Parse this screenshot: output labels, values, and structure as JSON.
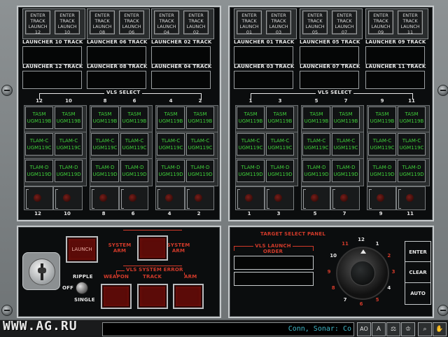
{
  "left_top": {
    "enter_buttons": [
      {
        "line1": "ENTER",
        "line2": "TRACK",
        "line3": "LAUNCH",
        "num": "12"
      },
      {
        "line1": "ENTER",
        "line2": "TRACK",
        "line3": "LAUNCH",
        "num": "10"
      },
      {
        "line1": "ENTER",
        "line2": "TRACK",
        "line3": "LAUNCH",
        "num": "08"
      },
      {
        "line1": "ENTER",
        "line2": "TRACK",
        "line3": "LAUNCH",
        "num": "06"
      },
      {
        "line1": "ENTER",
        "line2": "TRACK",
        "line3": "LAUNCH",
        "num": "04"
      },
      {
        "line1": "ENTER",
        "line2": "TRACK",
        "line3": "LAUNCH",
        "num": "02"
      }
    ],
    "track_labels_row1": [
      "LAUNCHER 10 TRACK",
      "LAUNCHER 06 TRACK",
      "LAUNCHER 02 TRACK"
    ],
    "track_labels_row2": [
      "LAUNCHER 12 TRACK",
      "LAUNCHER 08 TRACK",
      "LAUNCHER 04 TRACK"
    ],
    "vls_select": "VLS SELECT",
    "tube_numbers": [
      "12",
      "10",
      "8",
      "6",
      "4",
      "2"
    ]
  },
  "right_top": {
    "enter_buttons": [
      {
        "line1": "ENTER",
        "line2": "TRACK",
        "line3": "LAUNCH",
        "num": "01"
      },
      {
        "line1": "ENTER",
        "line2": "TRACK",
        "line3": "LAUNCH",
        "num": "03"
      },
      {
        "line1": "ENTER",
        "line2": "TRACK",
        "line3": "LAUNCH",
        "num": "05"
      },
      {
        "line1": "ENTER",
        "line2": "TRACK",
        "line3": "LAUNCH",
        "num": "07"
      },
      {
        "line1": "ENTER",
        "line2": "TRACK",
        "line3": "LAUNCH",
        "num": "09"
      },
      {
        "line1": "ENTER",
        "line2": "TRACK",
        "line3": "LAUNCH",
        "num": "11"
      }
    ],
    "track_labels_row1": [
      "LAUNCHER 01 TRACK",
      "LAUNCHER 05 TRACK",
      "LAUNCHER 09 TRACK"
    ],
    "track_labels_row2": [
      "LAUNCHER 03 TRACK",
      "LAUNCHER 07 TRACK",
      "LAUNCHER 11 TRACK"
    ],
    "vls_select": "VLS SELECT",
    "tube_numbers": [
      "1",
      "3",
      "5",
      "7",
      "9",
      "11"
    ]
  },
  "weapons": [
    {
      "l1": "TASM",
      "l2": "UGM119B"
    },
    {
      "l1": "TLAM-C",
      "l2": "UGM119C"
    },
    {
      "l1": "TLAM-D",
      "l2": "UGM119D"
    }
  ],
  "control": {
    "launch": "LAUNCH",
    "system_arm_left": "SYSTEM ARM",
    "system_arm_right": "SYSTEM ARM",
    "ripple": "RIPPLE",
    "off": "OFF",
    "single": "SINGLE",
    "error_title": "VLS SYSTEM ERROR",
    "weapon": "WEAPON",
    "track": "TRACK",
    "arm": "ARM"
  },
  "target": {
    "title": "TARGET SELECT PANEL",
    "order_title": "VLS LAUNCH ORDER",
    "dial_numbers": [
      "1",
      "2",
      "3",
      "4",
      "5",
      "6",
      "7",
      "8",
      "9",
      "10",
      "11",
      "12"
    ],
    "enter": "ENTER",
    "clear": "CLEAR",
    "auto": "AUTO"
  },
  "bottom": {
    "watermark": "WWW.AG.RU",
    "message": "Conn, Sonar: Co",
    "ao": "AO",
    "icons": [
      "A",
      "⚖",
      "♔",
      "☒",
      "⌕",
      "✋"
    ]
  },
  "colors": {
    "accent_red": "#d23a2a",
    "weapon_green": "#3fcf3a"
  }
}
